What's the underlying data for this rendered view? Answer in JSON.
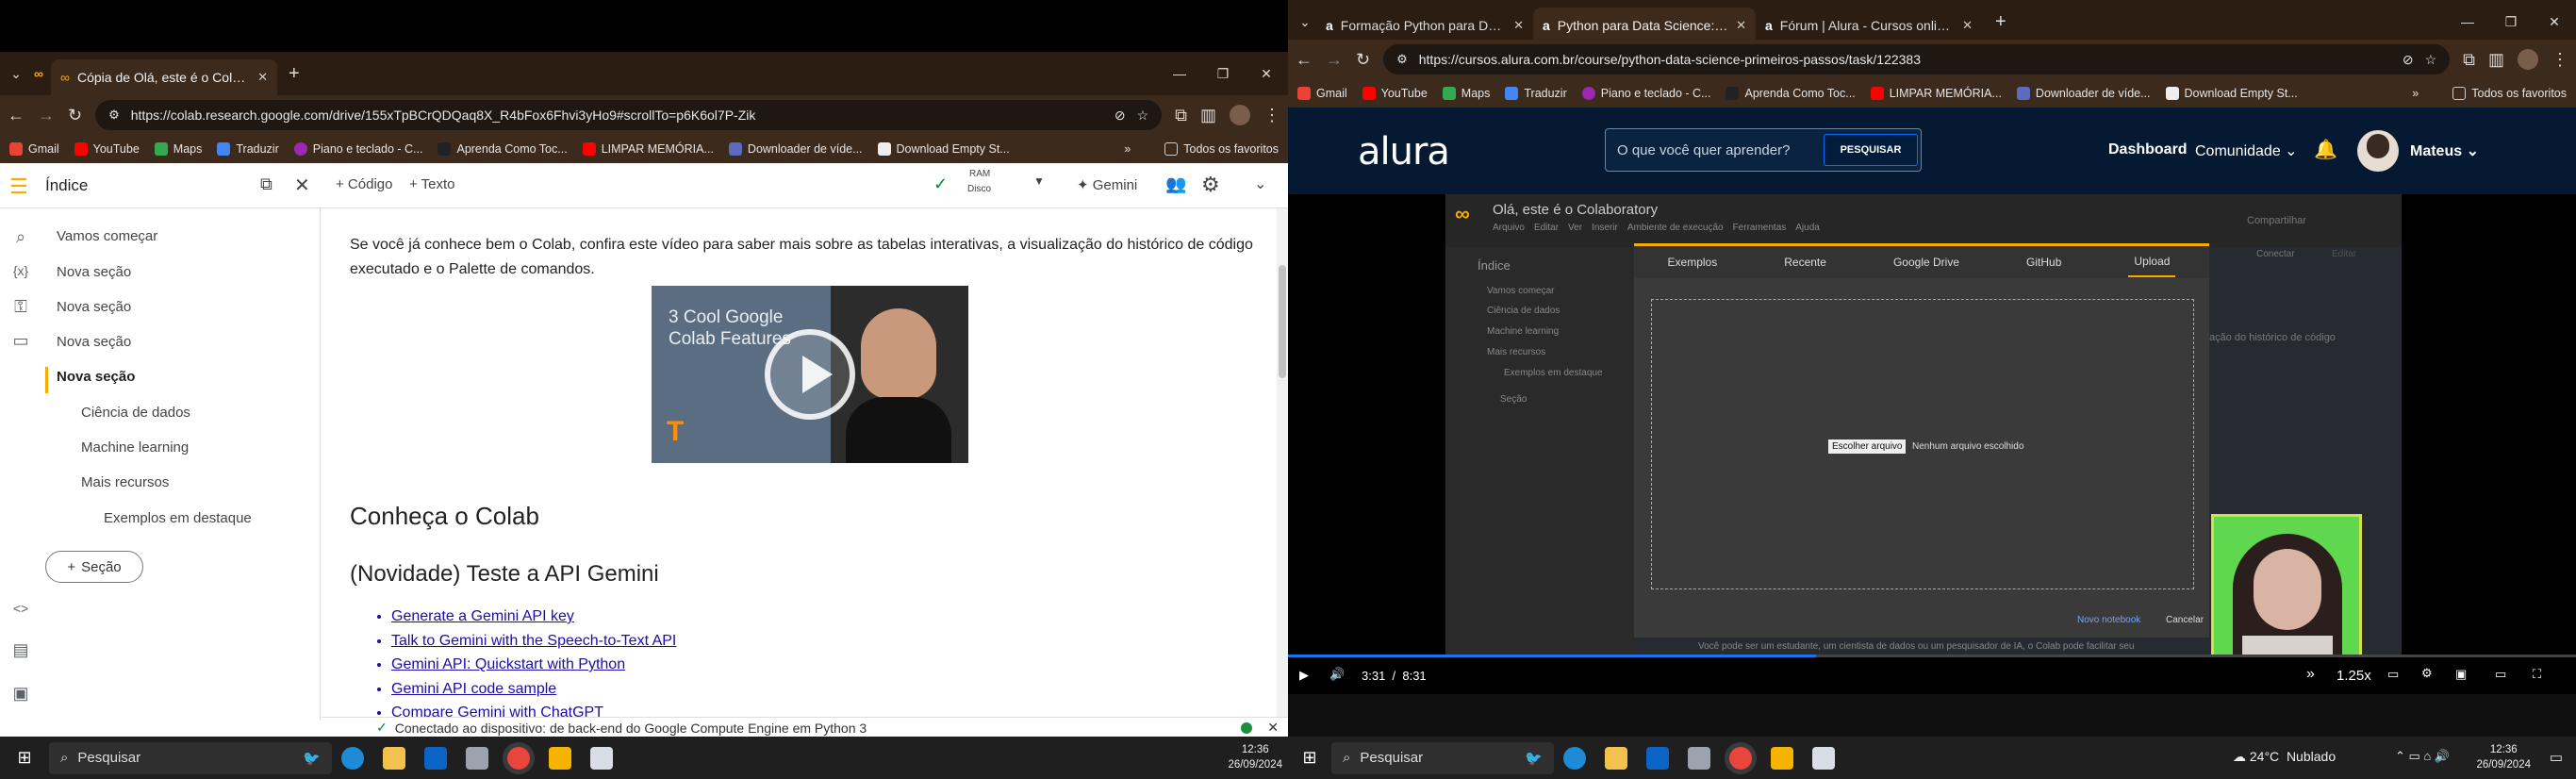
{
  "left": {
    "tab": {
      "title": "Cópia de Olá, este é o Colaborat",
      "new": "+"
    },
    "url": "https://colab.research.google.com/drive/155xTpBCrQDQaq8X_R4bFox6Fhvi3yHo9#scrollTo=p6K6ol7P-Zik",
    "bookmarks": [
      "Gmail",
      "YouTube",
      "Maps",
      "Traduzir",
      "Piano e teclado - C...",
      "Aprenda Como Toc...",
      "LIMPAR MEMÓRIA...",
      "Downloader de víde...",
      "Download Empty St..."
    ],
    "bookmarks_more": "»",
    "all_bookmarks": "Todos os favoritos",
    "colab": {
      "toc_title": "Índice",
      "add_code": "+ Código",
      "add_text": "+ Texto",
      "ram": "RAM",
      "disk": "Disco",
      "gemini": "Gemini",
      "toc_items": [
        {
          "label": "Vamos começar",
          "level": 1
        },
        {
          "label": "Nova seção",
          "level": 1
        },
        {
          "label": "Nova seção",
          "level": 1
        },
        {
          "label": "Nova seção",
          "level": 1
        },
        {
          "label": "Nova seção",
          "level": 1,
          "active": true
        },
        {
          "label": "Ciência de dados",
          "level": 2
        },
        {
          "label": "Machine learning",
          "level": 2
        },
        {
          "label": "Mais recursos",
          "level": 2
        },
        {
          "label": "Exemplos em destaque",
          "level": 3
        }
      ],
      "section_button": "Seção",
      "paragraph": "Se você já conhece bem o Colab, confira este vídeo para saber mais sobre as tabelas interativas, a visualização do histórico de código executado e o Palette de comandos.",
      "video_caption": "3 Cool Google\nColab Features",
      "heading1": "Conheça o Colab",
      "heading2": "(Novidade) Teste a API Gemini",
      "links": [
        "Generate a Gemini API key",
        "Talk to Gemini with the Speech-to-Text API",
        "Gemini API: Quickstart with Python",
        "Gemini API code sample",
        "Compare Gemini with ChatGPT"
      ],
      "status": "Conectado ao dispositivo: de back-end do Google Compute Engine em Python 3"
    },
    "taskbar": {
      "search": "Pesquisar",
      "time": "12:36",
      "date": "26/09/2024"
    }
  },
  "right": {
    "tabs": [
      {
        "title": "Formação Python para Data Sc",
        "active": false
      },
      {
        "title": "Python para Data Science: prim",
        "active": true
      },
      {
        "title": "Fórum | Alura - Cursos online d",
        "active": false
      }
    ],
    "url": "https://cursos.alura.com.br/course/python-data-science-primeiros-passos/task/122383",
    "bookmarks": [
      "Gmail",
      "YouTube",
      "Maps",
      "Traduzir",
      "Piano e teclado - C...",
      "Aprenda Como Toc...",
      "LIMPAR MEMÓRIA...",
      "Downloader de víde...",
      "Download Empty St..."
    ],
    "all_bookmarks": "Todos os favoritos",
    "alura": {
      "logo": "alura",
      "search_placeholder": "O que você quer aprender?",
      "search_button": "PESQUISAR",
      "dashboard": "Dashboard",
      "community": "Comunidade",
      "user": "Mateus"
    },
    "video": {
      "colab_title": "Olá, este é o Colaboratory",
      "menu": [
        "Arquivo",
        "Editar",
        "Ver",
        "Inserir",
        "Ambiente de execução",
        "Ferramentas",
        "Ajuda"
      ],
      "share": "Compartilhar",
      "toc_title": "Índice",
      "toc_items": [
        "Vamos começar",
        "Ciência de dados",
        "Machine learning",
        "Mais recursos",
        "Exemplos em destaque",
        "Seção"
      ],
      "dialog_tabs": [
        "Exemplos",
        "Recente",
        "Google Drive",
        "GitHub",
        "Upload"
      ],
      "choose_file": "Escolher arquivo",
      "no_file": "Nenhum arquivo escolhido",
      "new_notebook": "Novo notebook",
      "cancel": "Cancelar",
      "connect": "Conectar",
      "edit": "Editar",
      "bg_text": "ação do histórico de código",
      "caption": "Você pode ser um estudante, um cientista de dados ou um pesquisador de IA, o Colab pode facilitar seu",
      "time": "3:31  /  8:31",
      "progress": 0.41,
      "speed": "1.25x"
    },
    "taskbar": {
      "search": "Pesquisar",
      "weather": "24°C  Nublado",
      "time": "12:36",
      "date": "26/09/2024"
    }
  }
}
